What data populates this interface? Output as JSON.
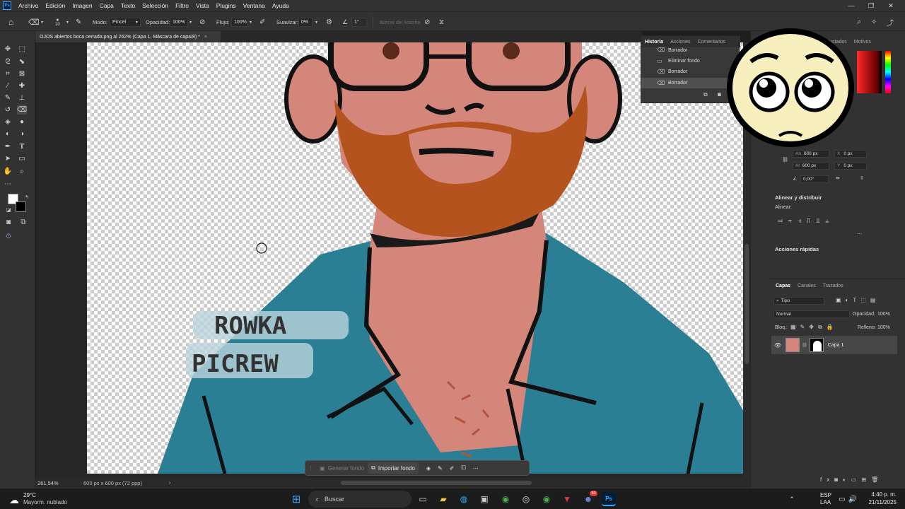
{
  "menubar": {
    "items": [
      "Archivo",
      "Edición",
      "Imagen",
      "Capa",
      "Texto",
      "Selección",
      "Filtro",
      "Vista",
      "Plugins",
      "Ventana",
      "Ayuda"
    ]
  },
  "options": {
    "brush_size": "10",
    "mode_label": "Modo:",
    "mode_value": "Pincel",
    "opacity_label": "Opacidad:",
    "opacity_value": "100%",
    "flow_label": "Flujo:",
    "flow_value": "100%",
    "smooth_label": "Suavizar:",
    "smooth_value": "0%",
    "angle_value": "1°",
    "erase_history": "Borrar de historia"
  },
  "document": {
    "tab_title": "OJOS abiertos boca cerrada.png al 262% (Capa 1, Máscara de capa/8) *",
    "close": "×"
  },
  "canvas": {
    "watermark_line1": "ROWKA",
    "watermark_line2": "PICREW"
  },
  "statusbar": {
    "zoom": "261,54%",
    "doc_info": "600 px x 600 px (72 ppp)"
  },
  "taskbar_ctx": {
    "generate": "Generar fondo",
    "import": "Importar fondo"
  },
  "history": {
    "tabs": [
      "Historia",
      "Acciones",
      "Comentarios"
    ],
    "items": [
      "Borrador",
      "Eliminar fondo",
      "Borrador",
      "Borrador"
    ]
  },
  "dock": {
    "top_tabs": [
      "Ajustados",
      "Motivos"
    ],
    "props": {
      "width_label": "An",
      "width": "600 px",
      "height_label": "Al",
      "height": "600 px",
      "x_label": "X",
      "x": "0 px",
      "y_label": "Y",
      "y": "0 px",
      "angle": "0,00°"
    },
    "align_title": "Alinear y distribuir",
    "align_label": "Alinear:",
    "quick_title": "Acciones rápidas",
    "layers_tabs": [
      "Capas",
      "Canales",
      "Trazados"
    ],
    "filter_kind": "Tipo",
    "blend_mode": "Normal",
    "opacity_label": "Opacidad:",
    "opacity": "100%",
    "lock_label": "Bloq.:",
    "fill_label": "Relleno:",
    "fill": "100%",
    "layer_name": "Capa 1"
  },
  "taskbar": {
    "weather_temp": "29°C",
    "weather_desc": "Mayorm. nublado",
    "search": "Buscar",
    "lang_line1": "ESP",
    "lang_line2": "LAA",
    "time": "4:40 p. m.",
    "date": "21/11/2025",
    "discord_badge": "50"
  },
  "colors": {
    "accent": "#31a8ff",
    "shirt": "#2a7f94",
    "skin": "#d4867a",
    "beard": "#b5531f"
  }
}
